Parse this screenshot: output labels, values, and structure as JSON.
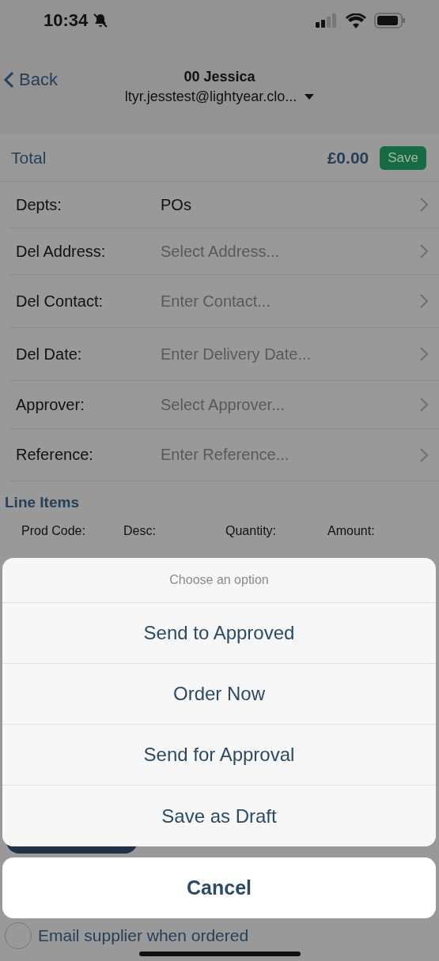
{
  "status_bar": {
    "time": "10:34"
  },
  "header": {
    "back_label": "Back",
    "title": "00 Jessica",
    "subtitle": "ltyr.jesstest@lightyear.clo..."
  },
  "total": {
    "label": "Total",
    "amount": "£0.00",
    "save_label": "Save"
  },
  "fields": [
    {
      "label": "Depts:",
      "value": "POs"
    },
    {
      "label": "Del Address:",
      "placeholder": "Select Address..."
    },
    {
      "label": "Del Contact:",
      "placeholder": "Enter Contact..."
    },
    {
      "label": "Del Date:",
      "placeholder": "Enter Delivery Date..."
    },
    {
      "label": "Approver:",
      "placeholder": "Select Approver..."
    },
    {
      "label": "Reference:",
      "placeholder": "Enter Reference..."
    }
  ],
  "line_items": {
    "title": "Line Items",
    "columns": [
      "Prod Code:",
      "Desc:",
      "Quantity:",
      "Amount:"
    ]
  },
  "action_sheet": {
    "title": "Choose an option",
    "options": [
      "Send to Approved",
      "Order Now",
      "Send for Approval",
      "Save as Draft"
    ],
    "cancel": "Cancel"
  },
  "email_option": {
    "label": "Email supplier when ordered",
    "checked": false
  }
}
